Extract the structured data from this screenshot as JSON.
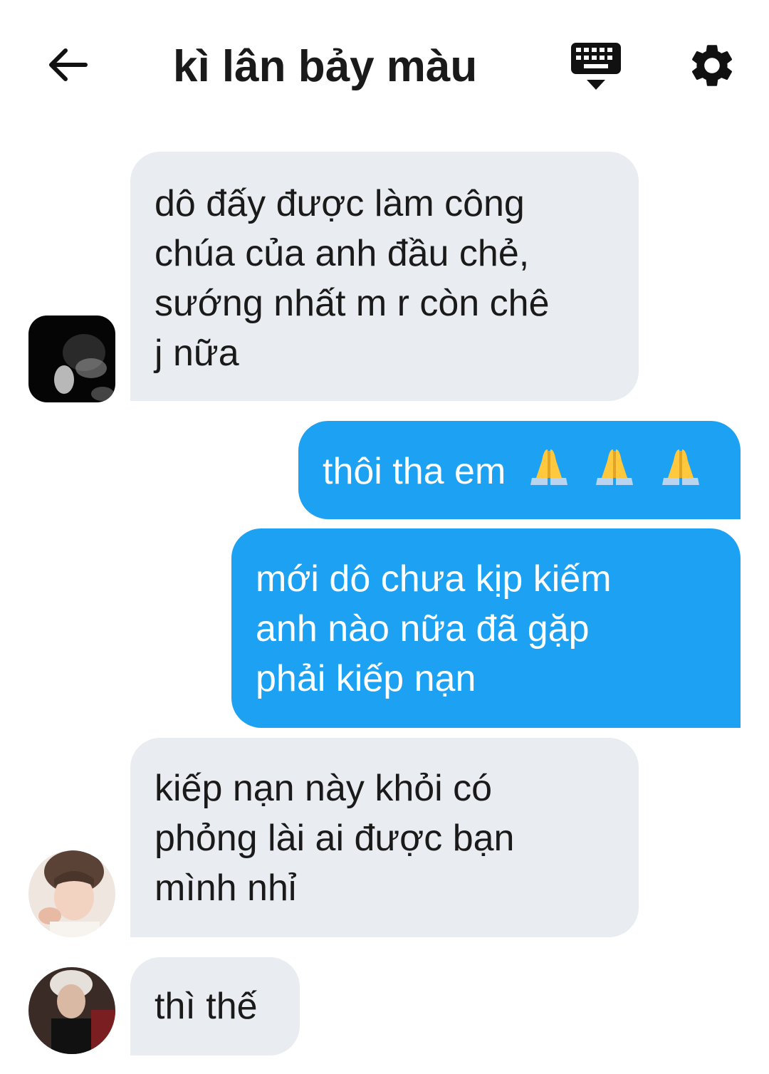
{
  "header": {
    "title": "kì lân bảy màu",
    "back_icon": "arrow-left-icon",
    "keyboard_icon": "keyboard-icon",
    "settings_icon": "gear-icon"
  },
  "colors": {
    "incoming_bubble": "#e9ecf0",
    "outgoing_bubble": "#1da1f2",
    "text_dark": "#1a1a1a"
  },
  "messages": [
    {
      "direction": "incoming",
      "lines": [
        "dô đấy được làm công",
        "chúa của anh đầu chẻ,",
        "sướng nhất m r còn chê",
        "j nữa"
      ]
    },
    {
      "direction": "outgoing",
      "lines": [
        "thôi tha em"
      ],
      "emoji": [
        "🙏",
        "🙏",
        "🙏"
      ]
    },
    {
      "direction": "outgoing",
      "lines": [
        "mới dô chưa kịp kiếm",
        "anh nào nữa đã gặp",
        "phải kiếp nạn"
      ]
    },
    {
      "direction": "incoming",
      "lines": [
        "kiếp nạn này khỏi có",
        "phỏng lài ai được bạn",
        "mình nhỉ"
      ]
    },
    {
      "direction": "incoming",
      "lines": [
        "thì thế"
      ]
    }
  ]
}
